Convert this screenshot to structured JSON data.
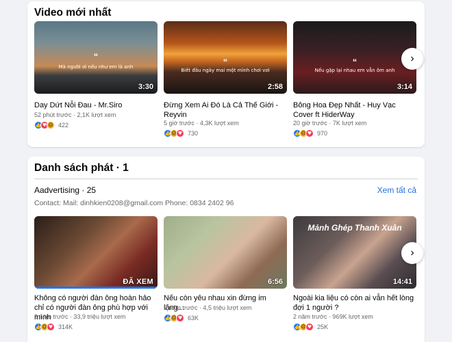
{
  "latest": {
    "title": "Video mới nhất",
    "videos": [
      {
        "title": "Day Dứt Nỗi Đau - Mr.Siro",
        "meta": "52 phút trước · 2,1K lượt xem",
        "reactions": "422",
        "duration": "3:30",
        "quote": "Mà người ơi nếu như em là anh"
      },
      {
        "title": "Đừng Xem Ai Đó Là Cả Thế Giới - Reyvin",
        "meta": "5 giờ trước · 4,3K lượt xem",
        "reactions": "730",
        "duration": "2:58",
        "quote": "Biết đâu ngày mai một mình chơi vơi"
      },
      {
        "title": "Bông Hoa Đẹp Nhất - Huy Vạc Cover ft HiderWay",
        "meta": "20 giờ trước · 7K lượt xem",
        "reactions": "970",
        "duration": "3:14",
        "quote": "Nếu gặp lại nhau em vẫn ôm anh"
      }
    ]
  },
  "playlist": {
    "title": "Danh sách phát · 1",
    "name": "Aadvertising · 25",
    "see_all": "Xem tất cả",
    "contact": "Contact: Mail: dinhkien0208@gmail.com Phone: 0834 2402 96",
    "videos": [
      {
        "title": "Không có người đàn ông hoàn hảo chỉ có người đàn ông phù hợp với mình",
        "meta": "2 năm trước · 33,9 triệu lượt xem",
        "reactions": "314K",
        "badge": "ĐÃ XEM",
        "progress": 1.0
      },
      {
        "title": "Nếu còn yêu nhau xin đừng im lặng...",
        "meta": "2 năm trước · 4,5 triệu lượt xem",
        "reactions": "63K",
        "badge": "6:56",
        "progress": 0
      },
      {
        "title": "Ngoài kia liệu có còn ai vẫn hết lòng đợi 1 người ?",
        "meta": "2 năm trước · 969K lượt xem",
        "reactions": "25K",
        "badge": "14:41",
        "progress": 0,
        "overlay": "Mảnh Ghép Thanh Xuân"
      }
    ]
  },
  "icons": {
    "next": "chevron-right-icon",
    "quote": "quote-icon"
  },
  "colors": {
    "link": "#216fdb",
    "like": "#1877f2",
    "love": "#f33e58",
    "haha": "#f7b125"
  }
}
